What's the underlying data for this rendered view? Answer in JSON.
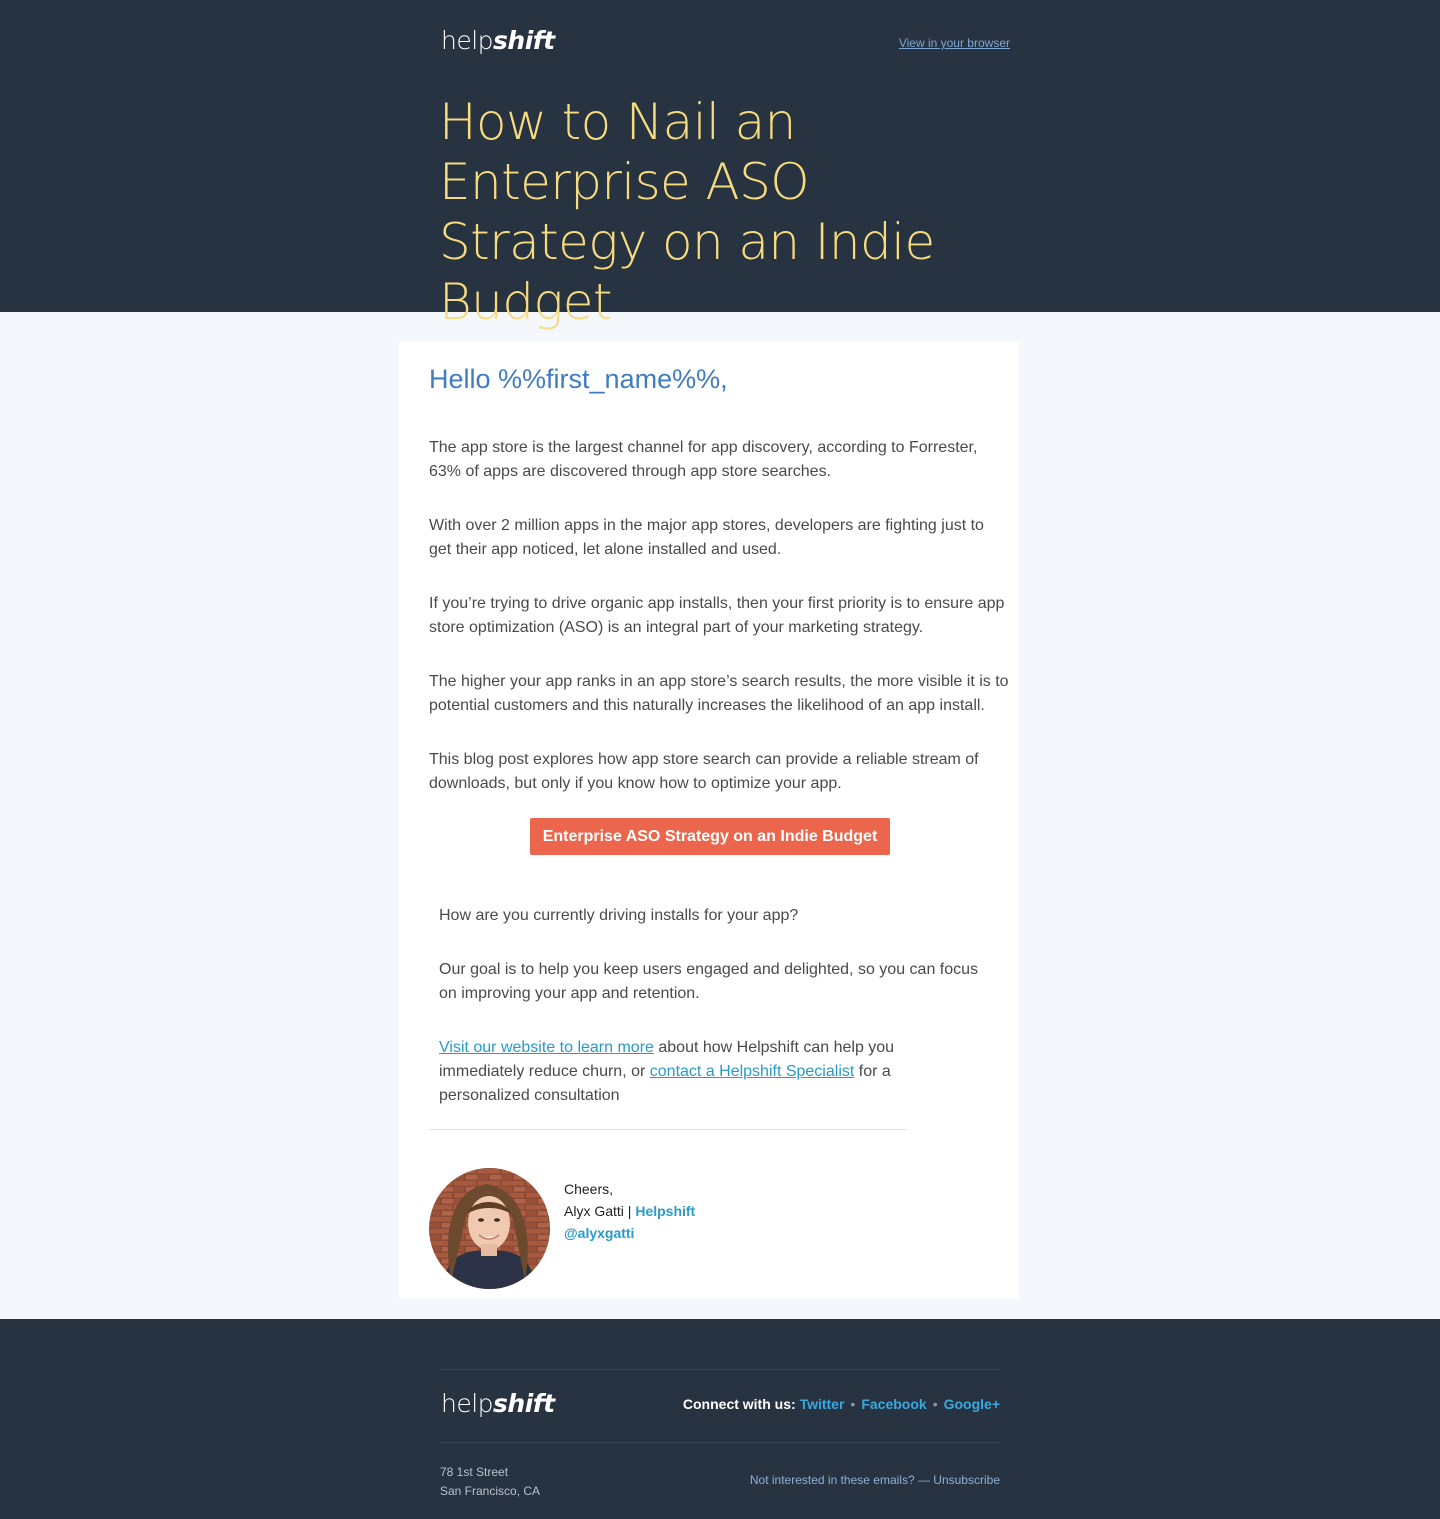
{
  "header": {
    "logo_part1": "help",
    "logo_part2": "shift",
    "view_in_browser": "View in your browser",
    "headline": "How to Nail an Enterprise ASO Strategy on an Indie Budget"
  },
  "body": {
    "greeting": "Hello %%first_name%%,",
    "paragraphs": [
      "The app store is the largest channel for app discovery, according to Forrester, 63% of apps are discovered through app store searches.",
      "With over 2 million apps in the major app stores, developers are fighting just to get their app noticed, let alone installed and used.",
      "If you’re trying to drive organic app installs, then your first priority is to ensure app store optimization (ASO) is an integral part of your marketing strategy.",
      "The higher your app ranks in an app store’s search results, the more visible it is to potential customers and this naturally increases the likelihood of an app install.",
      "This blog post explores how app store search can provide a reliable stream of downloads, but only if you know how to optimize your app."
    ],
    "cta_label": "Enterprise ASO Strategy on an Indie Budget",
    "question": "How are you currently driving installs for your app?",
    "goal": "Our goal is to help you keep users engaged and delighted, so you can focus on improving your app and retention.",
    "visit_link": "Visit our website to learn more",
    "visit_text": " about how Helpshift can help you immediately reduce churn, or ",
    "contact_link": "contact a Helpshift Specialist",
    "contact_text": " for a personalized consultation"
  },
  "signature": {
    "cheers": "Cheers,",
    "name": "Alyx Gatti",
    "separator": " | ",
    "company": "Helpshift",
    "handle": "@alyxgatti"
  },
  "footer": {
    "logo_part1": "help",
    "logo_part2": "shift",
    "connect_label": "Connect with us:",
    "social": [
      "Twitter",
      "Facebook",
      "Google+"
    ],
    "address_line1": "78 1st Street",
    "address_line2": "San Francisco, CA",
    "unsubscribe": "Not interested in these emails? — Unsubscribe"
  },
  "colors": {
    "header_bg": "#283341",
    "headline": "#f7db7f",
    "greeting": "#3f7cc2",
    "cta": "#eb664c",
    "link": "#2a9ac9"
  }
}
